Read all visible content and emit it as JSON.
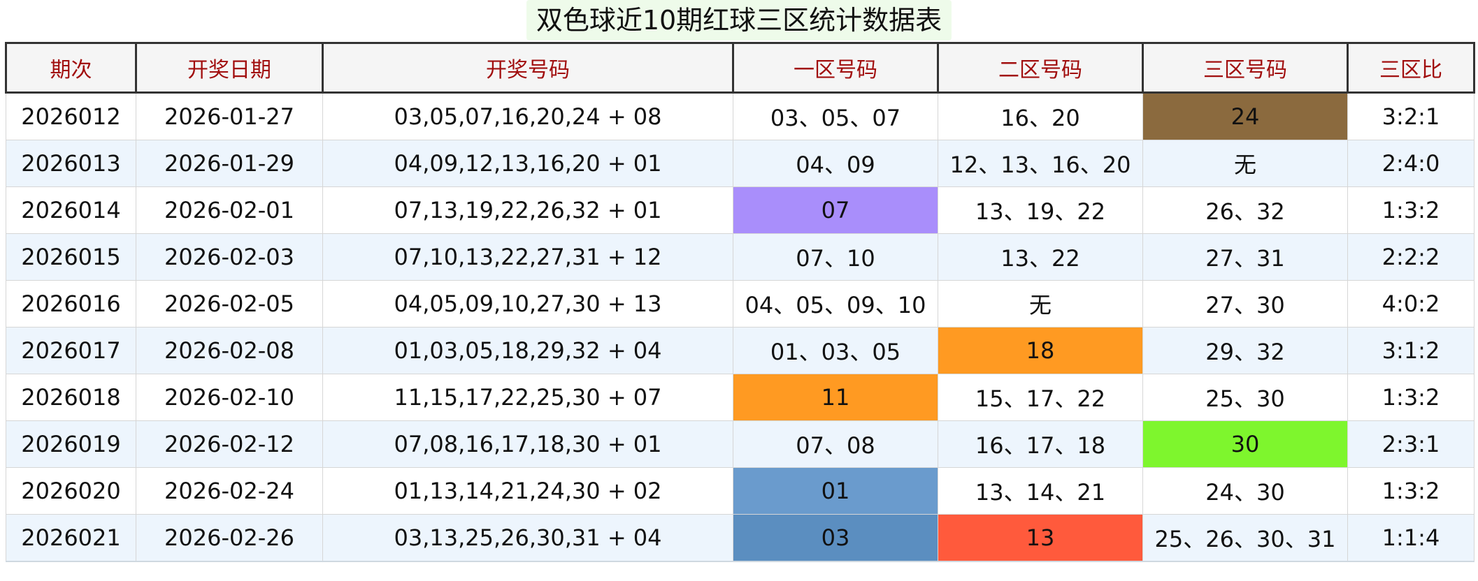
{
  "title": "双色球近10期红球三区统计数据表",
  "columns": [
    "期次",
    "开奖日期",
    "开奖号码",
    "一区号码",
    "二区号码",
    "三区号码",
    "三区比"
  ],
  "colors": {
    "header_text": "#a10e0e",
    "row_alt": "#edf5fd",
    "brown": "#8b6a3e",
    "purple": "#a98efb",
    "orange": "#ff9a22",
    "green": "#7ef62d",
    "blue": "#6a9bcd",
    "steel_blue": "#5b8ec0",
    "red": "#ff5a3c"
  },
  "rows": [
    {
      "issue": "2026012",
      "date": "2026-01-27",
      "numbers": "03,05,07,16,20,24 + 08",
      "zone1": "03、05、07",
      "zone2": "16、20",
      "zone3": "24",
      "ratio": "3:2:1",
      "zone1_color": "",
      "zone2_color": "",
      "zone3_color": "#8b6a3e"
    },
    {
      "issue": "2026013",
      "date": "2026-01-29",
      "numbers": "04,09,12,13,16,20 + 01",
      "zone1": "04、09",
      "zone2": "12、13、16、20",
      "zone3": "无",
      "ratio": "2:4:0",
      "zone1_color": "",
      "zone2_color": "",
      "zone3_color": ""
    },
    {
      "issue": "2026014",
      "date": "2026-02-01",
      "numbers": "07,13,19,22,26,32 + 01",
      "zone1": "07",
      "zone2": "13、19、22",
      "zone3": "26、32",
      "ratio": "1:3:2",
      "zone1_color": "#a98efb",
      "zone2_color": "",
      "zone3_color": ""
    },
    {
      "issue": "2026015",
      "date": "2026-02-03",
      "numbers": "07,10,13,22,27,31 + 12",
      "zone1": "07、10",
      "zone2": "13、22",
      "zone3": "27、31",
      "ratio": "2:2:2",
      "zone1_color": "",
      "zone2_color": "",
      "zone3_color": ""
    },
    {
      "issue": "2026016",
      "date": "2026-02-05",
      "numbers": "04,05,09,10,27,30 + 13",
      "zone1": "04、05、09、10",
      "zone2": "无",
      "zone3": "27、30",
      "ratio": "4:0:2",
      "zone1_color": "",
      "zone2_color": "",
      "zone3_color": ""
    },
    {
      "issue": "2026017",
      "date": "2026-02-08",
      "numbers": "01,03,05,18,29,32 + 04",
      "zone1": "01、03、05",
      "zone2": "18",
      "zone3": "29、32",
      "ratio": "3:1:2",
      "zone1_color": "",
      "zone2_color": "#ff9a22",
      "zone3_color": ""
    },
    {
      "issue": "2026018",
      "date": "2026-02-10",
      "numbers": "11,15,17,22,25,30 + 07",
      "zone1": "11",
      "zone2": "15、17、22",
      "zone3": "25、30",
      "ratio": "1:3:2",
      "zone1_color": "#ff9a22",
      "zone2_color": "",
      "zone3_color": ""
    },
    {
      "issue": "2026019",
      "date": "2026-02-12",
      "numbers": "07,08,16,17,18,30 + 01",
      "zone1": "07、08",
      "zone2": "16、17、18",
      "zone3": "30",
      "ratio": "2:3:1",
      "zone1_color": "",
      "zone2_color": "",
      "zone3_color": "#7ef62d"
    },
    {
      "issue": "2026020",
      "date": "2026-02-24",
      "numbers": "01,13,14,21,24,30 + 02",
      "zone1": "01",
      "zone2": "13、14、21",
      "zone3": "24、30",
      "ratio": "1:3:2",
      "zone1_color": "#6a9bcd",
      "zone2_color": "",
      "zone3_color": ""
    },
    {
      "issue": "2026021",
      "date": "2026-02-26",
      "numbers": "03,13,25,26,30,31 + 04",
      "zone1": "03",
      "zone2": "13",
      "zone3": "25、26、30、31",
      "ratio": "1:1:4",
      "zone1_color": "#5b8ec0",
      "zone2_color": "#ff5a3c",
      "zone3_color": ""
    }
  ]
}
